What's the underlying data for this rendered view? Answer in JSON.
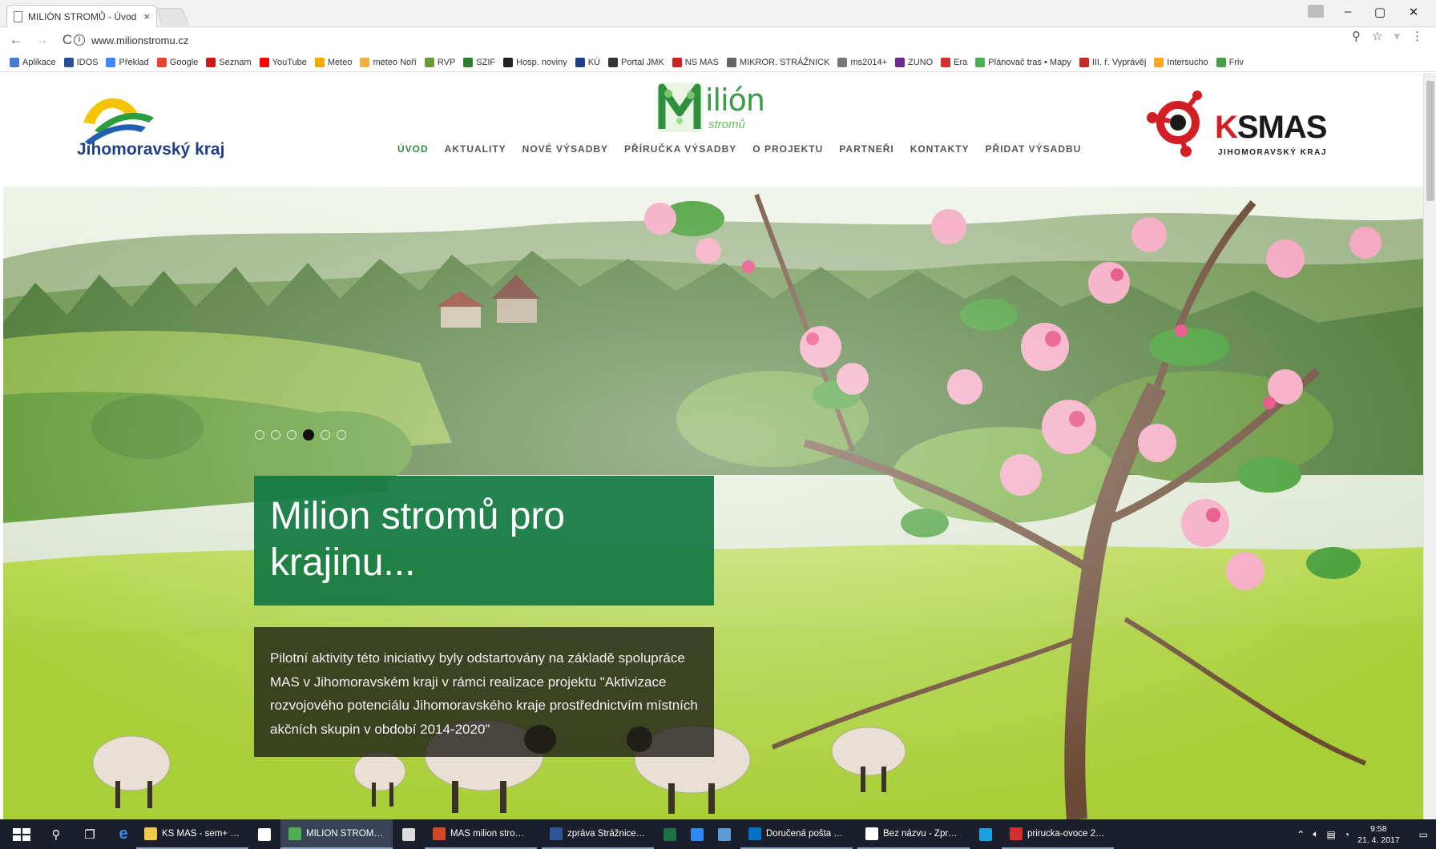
{
  "browser": {
    "tab_title": "MILIÓN STROMŮ - Úvod",
    "tab_close": "×",
    "url": "www.milionstromu.cz",
    "window_controls": [
      "–",
      "▢",
      "✕"
    ],
    "nav": {
      "back": "←",
      "forward": "→",
      "reload": "C"
    },
    "omnibox_icons": [
      "zoom-icon",
      "star-icon",
      "extension-icon",
      "menu-icon"
    ],
    "bookmarks": [
      {
        "label": "Aplikace",
        "color": "#4a7bd1"
      },
      {
        "label": "IDOS",
        "color": "#2b4f9b"
      },
      {
        "label": "Překlad",
        "color": "#4285f4"
      },
      {
        "label": "Google",
        "color": "#ea4335"
      },
      {
        "label": "Seznam",
        "color": "#cc1a1a"
      },
      {
        "label": "YouTube",
        "color": "#ff0000"
      },
      {
        "label": "Meteo",
        "color": "#f2a900"
      },
      {
        "label": "meteo Noří",
        "color": "#f0b040"
      },
      {
        "label": "RVP",
        "color": "#6a9a3a"
      },
      {
        "label": "SZIF",
        "color": "#2e7d32"
      },
      {
        "label": "Hosp. noviny",
        "color": "#222222"
      },
      {
        "label": "KÚ",
        "color": "#1f3f8a"
      },
      {
        "label": "Portal JMK",
        "color": "#333333"
      },
      {
        "label": "NS MAS",
        "color": "#d21f26"
      },
      {
        "label": "MIKROR. STRÁŽNICK",
        "color": "#666666"
      },
      {
        "label": "ms2014+",
        "color": "#777777"
      },
      {
        "label": "ZUNO",
        "color": "#6a2c91"
      },
      {
        "label": "Era",
        "color": "#d32f2f"
      },
      {
        "label": "Plánovač tras • Mapy",
        "color": "#4caf50"
      },
      {
        "label": "III. ř. Vyprávěj",
        "color": "#c62828"
      },
      {
        "label": "Intersucho",
        "color": "#f9a825"
      },
      {
        "label": "Friv",
        "color": "#43a047"
      }
    ]
  },
  "site": {
    "left_logo_text": "Jihomoravský kraj",
    "center_logo_word": "ilión",
    "center_logo_sub": "stromů",
    "right_logo_text_k": "K",
    "right_logo_text_rest": "SMAS",
    "right_logo_sub": "JIHOMORAVSKÝ KRAJ",
    "nav": [
      {
        "label": "ÚVOD",
        "active": true
      },
      {
        "label": "AKTUALITY",
        "active": false
      },
      {
        "label": "NOVÉ VÝSADBY",
        "active": false
      },
      {
        "label": "PŘÍRUČKA VÝSADBY",
        "active": false
      },
      {
        "label": "O PROJEKTU",
        "active": false
      },
      {
        "label": "PARTNEŘI",
        "active": false
      },
      {
        "label": "KONTAKTY",
        "active": false
      },
      {
        "label": "PŘIDAT VÝSADBU",
        "active": false
      }
    ],
    "accent_color": "#2f8f3e"
  },
  "hero": {
    "slide_count": 6,
    "active_slide": 4,
    "title": "Milion stromů pro krajinu...",
    "text": "Pilotní aktivity této iniciativy byly odstartovány na základě spolupráce MAS v Jihomoravském kraji v rámci realizace projektu \"Aktivizace rozvojového potenciálu Jihomoravského kraje prostřednictvím místních akčních skupin v období 2014-2020\""
  },
  "taskbar": {
    "apps": [
      {
        "label": "KS MAS - sem+ ov...",
        "color": "#f2c94c",
        "active": false
      },
      {
        "label": "",
        "color": "#ffffff",
        "active": false,
        "plain": true
      },
      {
        "label": "MILIÓN STROMŮ - ...",
        "color": "#4caf50",
        "active": true
      },
      {
        "label": "",
        "color": "#dddddd",
        "active": false,
        "plain": true
      },
      {
        "label": "MAS milion stromu...",
        "color": "#d24726",
        "active": false
      },
      {
        "label": "zpráva Strážnice-úv...",
        "color": "#2b5797",
        "active": false
      },
      {
        "label": "",
        "color": "#1e7145",
        "active": false,
        "plain": true
      },
      {
        "label": "",
        "color": "#2d89ef",
        "active": false,
        "plain": true
      },
      {
        "label": "",
        "color": "#5c9bd5",
        "active": false,
        "plain": true
      },
      {
        "label": "Doručená pošta - v...",
        "color": "#0072c6",
        "active": false
      },
      {
        "label": "Bez názvu - Zpráva ...",
        "color": "#ffffff",
        "active": false
      },
      {
        "label": "",
        "color": "#1ba1e2",
        "active": false,
        "plain": true
      },
      {
        "label": "prirucka-ovoce 2str...",
        "color": "#d32f2f",
        "active": false
      }
    ],
    "time": "9:58",
    "date": "21. 4. 2017"
  }
}
